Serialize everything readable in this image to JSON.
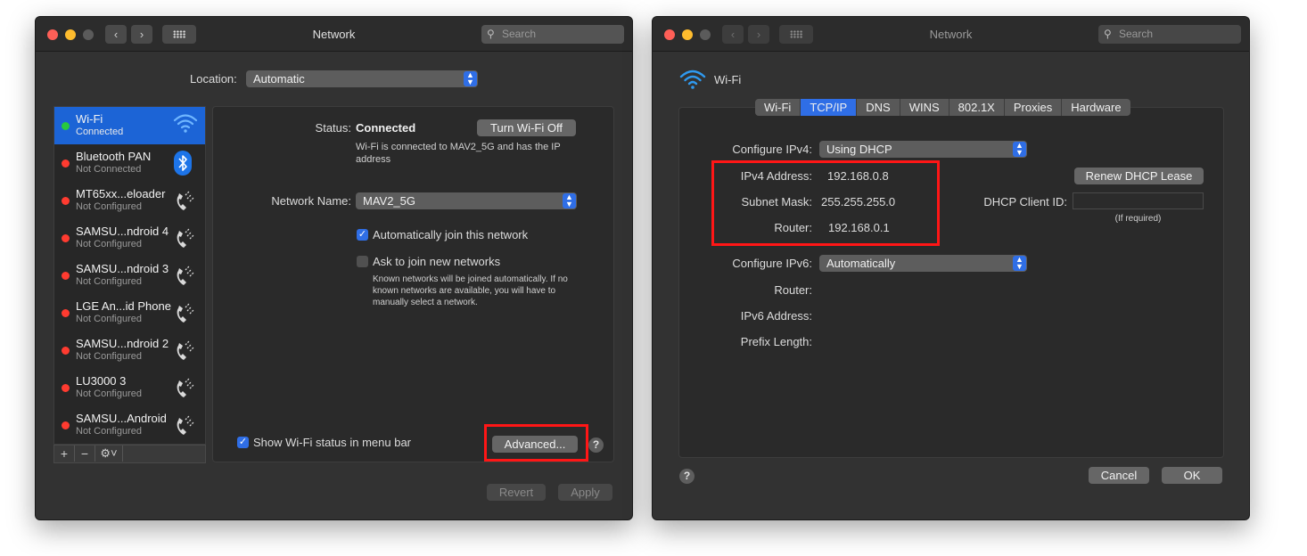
{
  "win1": {
    "title": "Network",
    "search_placeholder": "Search",
    "location_label": "Location:",
    "location_value": "Automatic",
    "services": [
      {
        "name": "Wi-Fi",
        "status": "Connected",
        "dot": "#27c93f",
        "icon": "wifi-icon",
        "selected": true
      },
      {
        "name": "Bluetooth PAN",
        "status": "Not Connected",
        "dot": "#ff3b30",
        "icon": "bluetooth-icon"
      },
      {
        "name": "MT65xx...eloader",
        "status": "Not Configured",
        "dot": "#ff3b30",
        "icon": "phone-icon"
      },
      {
        "name": "SAMSU...ndroid 4",
        "status": "Not Configured",
        "dot": "#ff3b30",
        "icon": "phone-icon"
      },
      {
        "name": "SAMSU...ndroid 3",
        "status": "Not Configured",
        "dot": "#ff3b30",
        "icon": "phone-icon"
      },
      {
        "name": "LGE An...id Phone",
        "status": "Not Configured",
        "dot": "#ff3b30",
        "icon": "phone-icon"
      },
      {
        "name": "SAMSU...ndroid 2",
        "status": "Not Configured",
        "dot": "#ff3b30",
        "icon": "phone-icon"
      },
      {
        "name": "LU3000 3",
        "status": "Not Configured",
        "dot": "#ff3b30",
        "icon": "phone-icon"
      },
      {
        "name": "SAMSU...Android",
        "status": "Not Configured",
        "dot": "#ff3b30",
        "icon": "phone-icon"
      }
    ],
    "status_label": "Status:",
    "status_value": "Connected",
    "turn_off_button": "Turn Wi-Fi Off",
    "status_desc": "Wi-Fi is connected to MAV2_5G and has the IP address",
    "network_name_label": "Network Name:",
    "network_name_value": "MAV2_5G",
    "auto_join_label": "Automatically join this network",
    "ask_join_label": "Ask to join new networks",
    "ask_join_desc": "Known networks will be joined automatically. If no known networks are available, you will have to manually select a network.",
    "show_status_label": "Show Wi-Fi status in menu bar",
    "advanced_button": "Advanced...",
    "revert_button": "Revert",
    "apply_button": "Apply"
  },
  "win2": {
    "title": "Network",
    "search_placeholder": "Search",
    "interface_name": "Wi-Fi",
    "tabs": [
      "Wi-Fi",
      "TCP/IP",
      "DNS",
      "WINS",
      "802.1X",
      "Proxies",
      "Hardware"
    ],
    "selected_tab": "TCP/IP",
    "configure_ipv4_label": "Configure IPv4:",
    "configure_ipv4_value": "Using DHCP",
    "ipv4_address_label": "IPv4 Address:",
    "ipv4_address_value": "192.168.0.8",
    "subnet_mask_label": "Subnet Mask:",
    "subnet_mask_value": "255.255.255.0",
    "router_label": "Router:",
    "router_value": "192.168.0.1",
    "renew_button": "Renew DHCP Lease",
    "dhcp_client_id_label": "DHCP Client ID:",
    "dhcp_client_id_value": "",
    "if_required": "(If required)",
    "configure_ipv6_label": "Configure IPv6:",
    "configure_ipv6_value": "Automatically",
    "router6_label": "Router:",
    "ipv6_address_label": "IPv6 Address:",
    "prefix_length_label": "Prefix Length:",
    "cancel_button": "Cancel",
    "ok_button": "OK"
  },
  "colors": {
    "accent": "#2f6ee6",
    "highlight": "#ff1616",
    "window_bg": "#323232"
  }
}
